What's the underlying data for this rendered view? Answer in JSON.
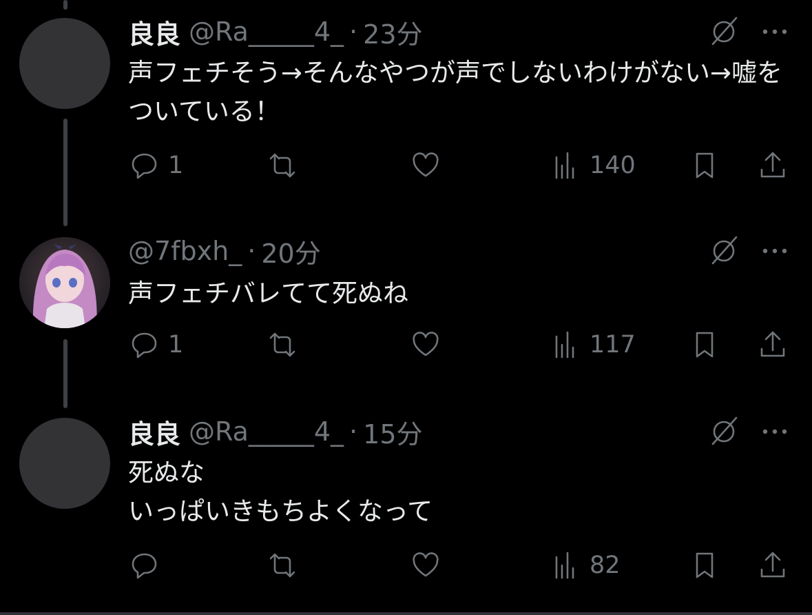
{
  "tweets": [
    {
      "name": "良良",
      "handle": "@Ra_____4_",
      "dot": "·",
      "time": "23分",
      "text": "声フェチそう→そんなやつが声でしないわけがない→嘘をついている！",
      "replies": "1",
      "retweets": "",
      "likes": "",
      "views": "140"
    },
    {
      "name": "",
      "handle": "@7fbxh_",
      "dot": "·",
      "time": "20分",
      "text": "声フェチバレてて死ぬね",
      "replies": "1",
      "retweets": "",
      "likes": "",
      "views": "117"
    },
    {
      "name": "良良",
      "handle": "@Ra_____4_",
      "dot": "·",
      "time": "15分",
      "text": "死ぬな\nいっぱいきもちよくなって",
      "replies": "",
      "retweets": "",
      "likes": "",
      "views": "82"
    }
  ],
  "icons": {
    "reply": "reply-icon",
    "retweet": "retweet-icon",
    "like": "heart-icon",
    "views": "views-icon",
    "bookmark": "bookmark-icon",
    "share": "share-icon",
    "grok": "grok-icon",
    "more": "more-icon"
  },
  "colors": {
    "background": "#000000",
    "text": "#e7e9ea",
    "muted": "#71767b",
    "thread_line": "#3e4144"
  }
}
